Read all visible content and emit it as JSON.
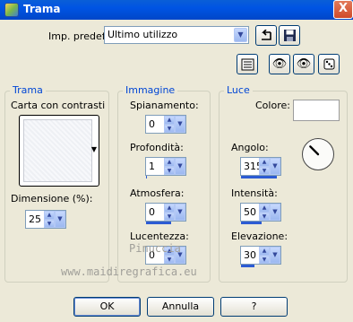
{
  "window": {
    "title": "Trama",
    "close_label": "X"
  },
  "presets": {
    "label": "Imp. predef.:",
    "value": "Ultimo utilizzo"
  },
  "groups": {
    "trama": {
      "title": "Trama",
      "texture_label": "Carta con contrasti",
      "size_label": "Dimensione (%):",
      "size_value": "25"
    },
    "immagine": {
      "title": "Immagine",
      "fields": [
        {
          "label": "Spianamento:",
          "value": "0",
          "level": 0
        },
        {
          "label": "Profondità:",
          "value": "1",
          "level": 0.02
        },
        {
          "label": "Atmosfera:",
          "value": "0",
          "level": 0.6
        },
        {
          "label": "Lucentezza:",
          "value": "0",
          "level": 0
        }
      ]
    },
    "luce": {
      "title": "Luce",
      "color_label": "Colore:",
      "color_value": "#ffffff",
      "fields": [
        {
          "label": "Angolo:",
          "value": "315",
          "level": 0.875
        },
        {
          "label": "Intensità:",
          "value": "50",
          "level": 0.5
        },
        {
          "label": "Elevazione:",
          "value": "30",
          "level": 0.33
        }
      ]
    }
  },
  "buttons": {
    "ok": "OK",
    "cancel": "Annulla",
    "help": "?"
  },
  "watermark": {
    "line1": "Pinuccia",
    "line2": "www.maidiregrafica.eu"
  },
  "colors": {
    "accent": "#0046d5",
    "titlebar": "#0054e3",
    "bar_fill": "#2c5bd3"
  }
}
